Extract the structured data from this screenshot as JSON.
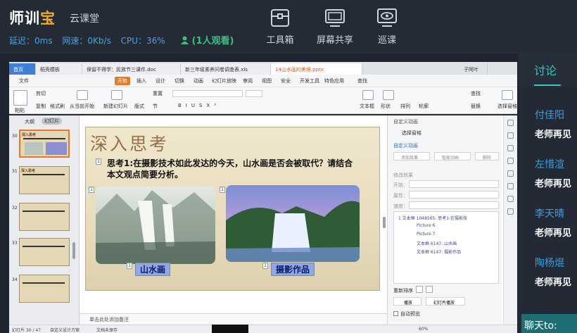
{
  "header": {
    "logo_main": "师训",
    "logo_sub": "宝",
    "subtitle": "云课堂",
    "stats": {
      "delay": "延迟：0ms",
      "network": "网速：0Kb/s",
      "cpu": "CPU：36%"
    },
    "viewers": "(1人观看)",
    "tools": [
      {
        "label": "工具箱",
        "icon": "toolbox-icon"
      },
      {
        "label": "屏幕共享",
        "icon": "screen-share-icon"
      },
      {
        "label": "巡课",
        "icon": "patrol-eye-icon"
      }
    ]
  },
  "sidebar": {
    "tab_label": "讨论",
    "messages": [
      {
        "name": "付佳阳",
        "content": "老师再见"
      },
      {
        "name": "左惜渲",
        "content": "老师再见"
      },
      {
        "name": "李天晴",
        "content": "老师再见"
      },
      {
        "name": "陶杨焜",
        "content": "老师再见"
      }
    ],
    "chat_button": "聊天to:"
  },
  "screen": {
    "tabs": [
      "首页",
      "稻壳模板",
      "保留不得学：民族节三课件.doc",
      "新三年级素养问卷调查表.xls",
      "14山水画的美境.pptx"
    ],
    "user": "子阿叶",
    "ribbon_tabs": [
      "文件",
      "开始",
      "插入",
      "设计",
      "切换",
      "动画",
      "幻灯片放映",
      "审阅",
      "视图",
      "安全",
      "开发工具",
      "特色应用",
      "查找"
    ],
    "ribbon_active": "开始",
    "ribbon_items": [
      "剪切",
      "复制",
      "格式刷",
      "粘贴",
      "从当前开始",
      "新建幻灯片",
      "版式",
      "节",
      "重置",
      "文本框",
      "形状",
      "排列",
      "轮廓",
      "查找",
      "替换",
      "选择窗格"
    ],
    "thumbs_header": {
      "outline": "大纲",
      "slides": "幻灯片"
    },
    "slide_numbers": [
      "30",
      "31",
      "32",
      "33",
      "34"
    ],
    "thumb_title": "深入思考",
    "slide": {
      "title": "深入思考",
      "question": "思考1:在摄影技术如此发达的今天，山水画是否会被取代？请结合本文观点简要分析。",
      "caption_left": "山水画",
      "caption_right": "摄影作品",
      "badge": "1"
    },
    "pane": {
      "title": "自定义动画",
      "select_window": "选择窗格",
      "custom_anim": "自定义动画",
      "add_effect": "添加效果",
      "smart_anim": "智能动画",
      "delete": "删除",
      "modify": "修改效果",
      "start": "开始：",
      "property": "属性：",
      "speed": "速度：",
      "list": [
        "1  文本框 1048565: 思考1:在摄影技",
        "Picture 6",
        "Picture 7",
        "文本框 6147: 山水画",
        "文本框 6147: 摄影作品"
      ],
      "reorder": "重新排序",
      "play": "播放",
      "slideshow": "幻灯片播放",
      "autopreview": "自动预览"
    },
    "notes": "单击此处添加备注",
    "status": {
      "slide": "幻灯片 30 / 47",
      "theme": "自定义设计方案",
      "doc": "文档未保存",
      "zoom": "60%"
    }
  }
}
